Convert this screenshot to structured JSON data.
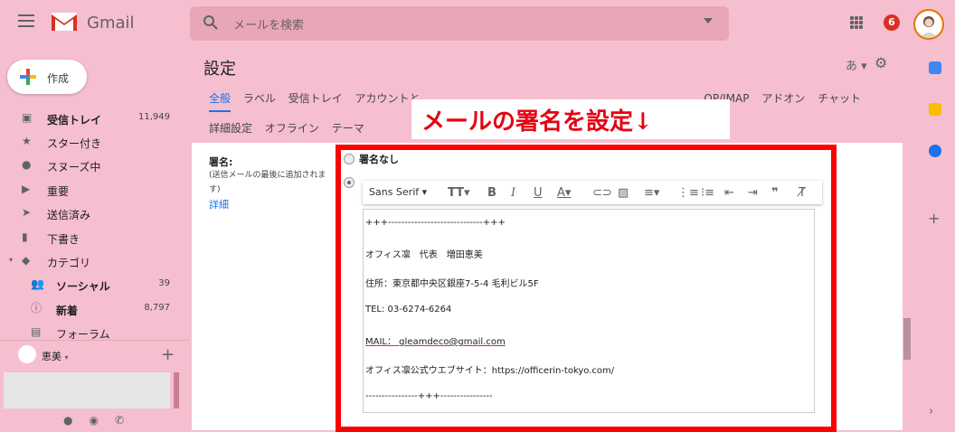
{
  "header": {
    "brand": "Gmail",
    "search_placeholder": "メールを検索",
    "notifications": "6"
  },
  "sidebar": {
    "compose": "作成",
    "items": [
      {
        "label": "受信トレイ",
        "count": "11,949",
        "icon": "inbox-icon",
        "bold": true
      },
      {
        "label": "スター付き",
        "count": "",
        "icon": "star-icon"
      },
      {
        "label": "スヌーズ中",
        "count": "",
        "icon": "snooze-icon"
      },
      {
        "label": "重要",
        "count": "",
        "icon": "important-icon"
      },
      {
        "label": "送信済み",
        "count": "",
        "icon": "send-icon"
      },
      {
        "label": "下書き",
        "count": "",
        "icon": "draft-icon"
      },
      {
        "label": "カテゴリ",
        "count": "",
        "icon": "label-icon"
      },
      {
        "label": "ソーシャル",
        "count": "39",
        "icon": "people-icon",
        "bold": true
      },
      {
        "label": "新着",
        "count": "8,797",
        "icon": "info-icon",
        "bold": true
      },
      {
        "label": "フォーラム",
        "count": "",
        "icon": "forum-icon"
      }
    ],
    "hangouts_user": "恵美"
  },
  "main": {
    "title": "設定",
    "lang": "あ",
    "tabs_row1": [
      "全般",
      "ラベル",
      "受信トレイ",
      "アカウントと",
      "",
      "",
      "",
      "",
      "OP/IMAP",
      "アドオン",
      "チャット"
    ],
    "tabs_row2": [
      "詳細設定",
      "オフライン",
      "テーマ"
    ],
    "signature": {
      "label": "署名:",
      "hint1": "(送信メールの最後に追加されま",
      "hint2": "す)",
      "more": "詳細",
      "no_signature": "署名なし",
      "font": "Sans Serif",
      "lines": [
        "+++-----------------------------+++",
        "オフィス凛　代表　増田恵美",
        "住所：東京都中央区銀座7-5-4 毛利ビル5F",
        "TEL: 03-6274-6264",
        "MAIL： gleamdeco@gmail.com",
        "オフィス凛公式ウエブサイト：https://officerin-tokyo.com/",
        "----------------+++----------------"
      ]
    }
  },
  "overlay": {
    "banner": "メールの署名を設定↓"
  },
  "colors": {
    "background": "#f5bfcf",
    "frame": "#ff0000",
    "banner_text": "#e60012",
    "accent": "#1a73e8"
  }
}
